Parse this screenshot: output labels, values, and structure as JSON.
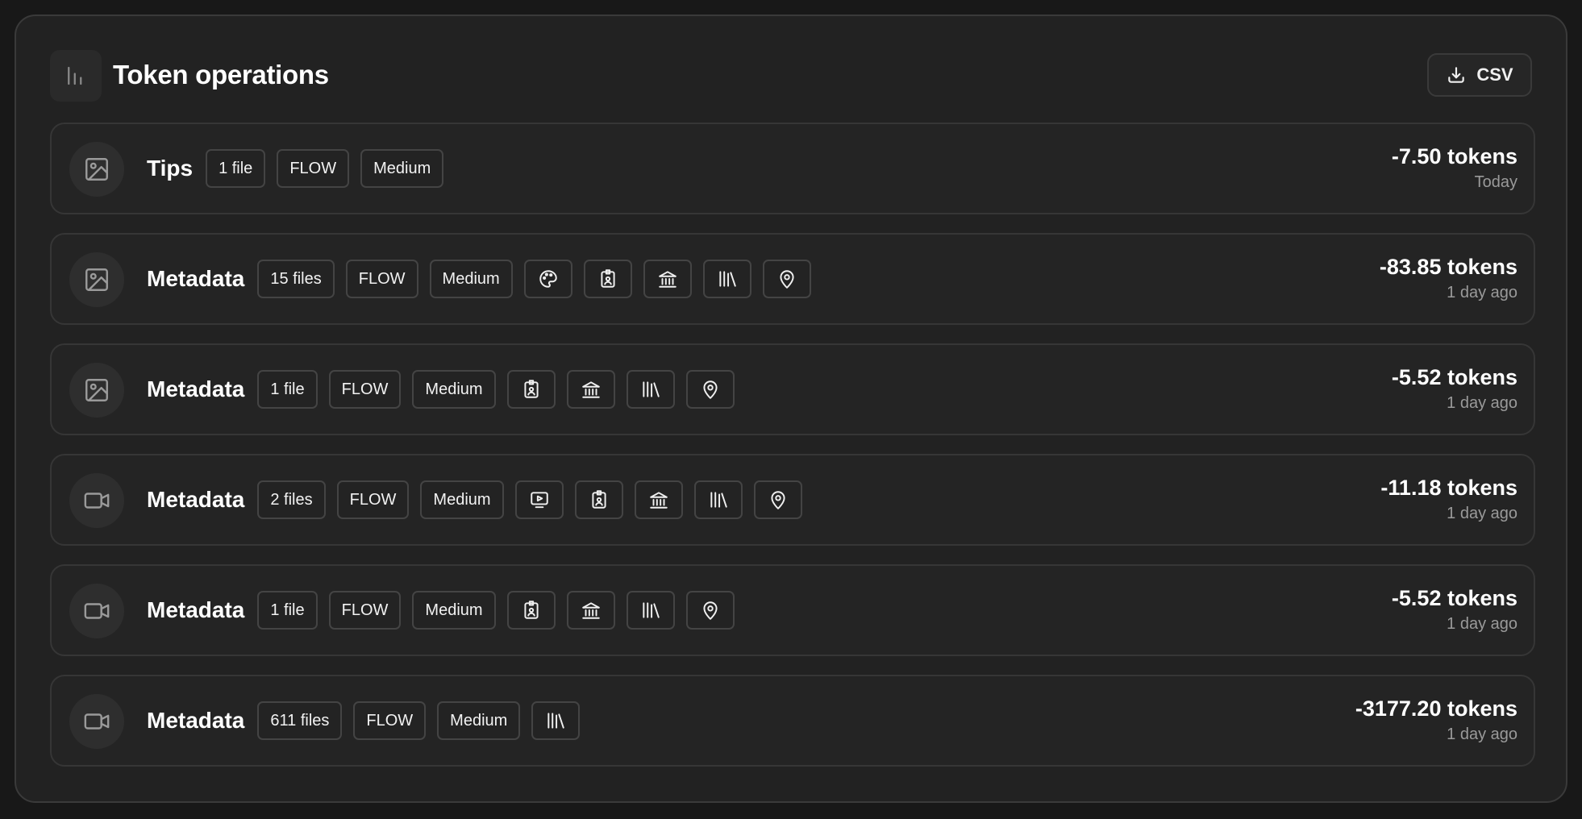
{
  "header": {
    "title": "Token operations",
    "icon": "bar-chart-icon",
    "export_label": "CSV",
    "export_icon": "download-icon"
  },
  "colors": {
    "background": "#181818",
    "panel": "#222222",
    "border": "#3a3a3a",
    "muted_text": "#9a9a9a"
  },
  "operations": [
    {
      "media": "image-icon",
      "title": "Tips",
      "files": "1 file",
      "engine": "FLOW",
      "quality": "Medium",
      "features": [],
      "amount": "-7.50 tokens",
      "when": "Today"
    },
    {
      "media": "image-icon",
      "title": "Metadata",
      "files": "15 files",
      "engine": "FLOW",
      "quality": "Medium",
      "features": [
        "palette-icon",
        "id-badge-icon",
        "bank-icon",
        "library-icon",
        "location-pin-icon"
      ],
      "amount": "-83.85 tokens",
      "when": "1 day ago"
    },
    {
      "media": "image-icon",
      "title": "Metadata",
      "files": "1 file",
      "engine": "FLOW",
      "quality": "Medium",
      "features": [
        "id-badge-icon",
        "bank-icon",
        "library-icon",
        "location-pin-icon"
      ],
      "amount": "-5.52 tokens",
      "when": "1 day ago"
    },
    {
      "media": "video-icon",
      "title": "Metadata",
      "files": "2 files",
      "engine": "FLOW",
      "quality": "Medium",
      "features": [
        "video-play-icon",
        "id-badge-icon",
        "bank-icon",
        "library-icon",
        "location-pin-icon"
      ],
      "amount": "-11.18 tokens",
      "when": "1 day ago"
    },
    {
      "media": "video-icon",
      "title": "Metadata",
      "files": "1 file",
      "engine": "FLOW",
      "quality": "Medium",
      "features": [
        "id-badge-icon",
        "bank-icon",
        "library-icon",
        "location-pin-icon"
      ],
      "amount": "-5.52 tokens",
      "when": "1 day ago"
    },
    {
      "media": "video-icon",
      "title": "Metadata",
      "files": "611 files",
      "engine": "FLOW",
      "quality": "Medium",
      "features": [
        "library-icon"
      ],
      "amount": "-3177.20 tokens",
      "when": "1 day ago"
    }
  ]
}
